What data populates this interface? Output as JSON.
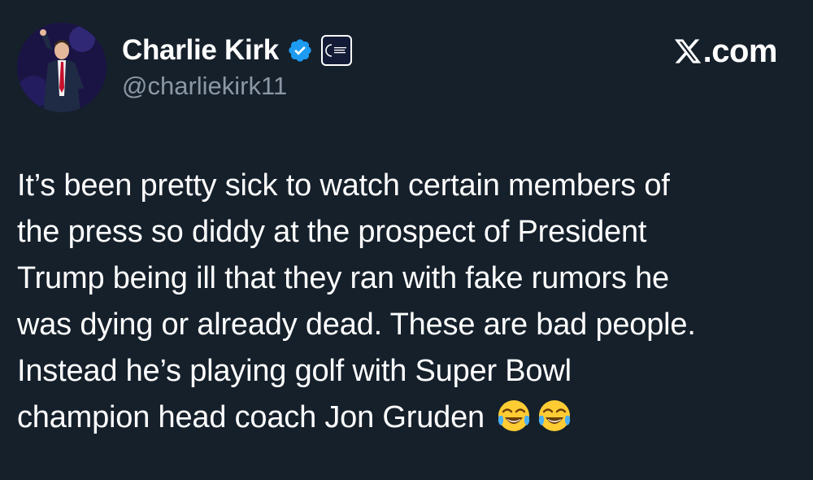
{
  "author": {
    "display_name": "Charlie Kirk",
    "handle": "@charliekirk11",
    "verified": true,
    "org_badge_text": "TURNING POINT USA"
  },
  "brand": {
    "label": "com"
  },
  "tweet": {
    "lines": [
      "It’s been pretty sick to watch certain members of",
      "the press so diddy at the prospect of President",
      "Trump being ill that they ran with fake rumors he",
      "was dying or already dead. These are bad people.",
      "Instead he’s playing golf with Super Bowl",
      "champion head coach Jon Gruden"
    ],
    "emojis": [
      "face-with-tears-of-joy-icon",
      "face-with-tears-of-joy-icon"
    ]
  },
  "colors": {
    "background": "#15202b",
    "text_primary": "#ffffff",
    "text_secondary": "#8b98a5",
    "verified_blue": "#1d9bf0"
  }
}
